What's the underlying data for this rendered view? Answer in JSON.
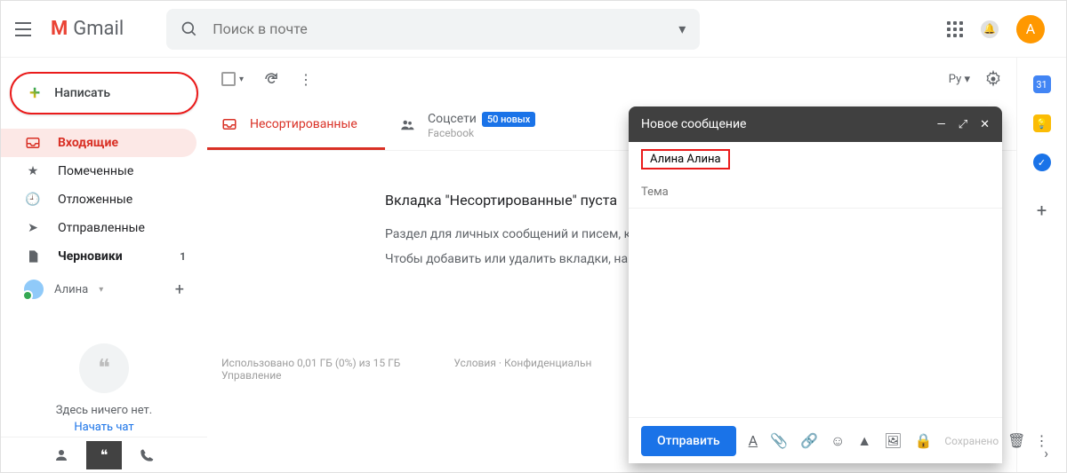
{
  "brand": "Gmail",
  "search": {
    "placeholder": "Поиск в почте"
  },
  "avatar_letter": "А",
  "compose": {
    "label": "Написать"
  },
  "nav": [
    {
      "icon": "inbox",
      "label": "Входящие",
      "active": true
    },
    {
      "icon": "star",
      "label": "Помеченные"
    },
    {
      "icon": "clock",
      "label": "Отложенные"
    },
    {
      "icon": "send",
      "label": "Отправленные"
    },
    {
      "icon": "draft",
      "label": "Черновики",
      "count": "1",
      "bold": true
    }
  ],
  "user_chip": {
    "name": "Алина"
  },
  "hangouts": {
    "empty": "Здесь ничего нет.",
    "cta": "Начать чат"
  },
  "toolbar": {
    "lang": "Ру"
  },
  "tabs": {
    "primary": "Несортированные",
    "social": "Соцсети",
    "social_badge": "50 новых",
    "social_sub": "Facebook"
  },
  "empty": {
    "title": "Вкладка \"Несортированные\" пуста",
    "line1": "Раздел для личных сообщений и писем, к",
    "line2": "Чтобы добавить или удалить вкладки, на"
  },
  "footer": {
    "storage": "Использовано 0,01 ГБ (0%) из 15 ГБ",
    "manage": "Управление",
    "terms": "Условия · Конфиденциальн"
  },
  "compose_window": {
    "title": "Новое сообщение",
    "recipient": "Алина Алина",
    "subject_placeholder": "Тема",
    "send": "Отправить",
    "saved": "Сохранено"
  },
  "calendar_day": "31"
}
